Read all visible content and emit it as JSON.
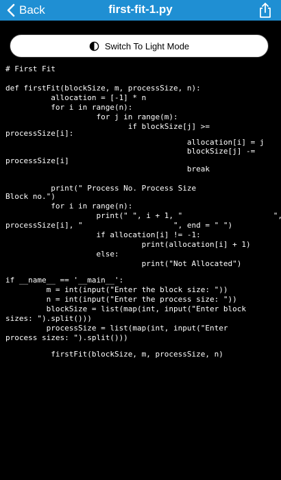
{
  "nav": {
    "back_label": "Back",
    "title": "first-fit-1.py",
    "icons": {
      "back": "chevron-left-icon",
      "share": "share-icon"
    }
  },
  "theme_toggle": {
    "label": "Switch To Light Mode",
    "icon": "half-moon-icon"
  },
  "colors": {
    "nav_bar": "#1f8fd3",
    "background": "#000000",
    "code_text": "#ffffff",
    "button_bg": "#ffffff"
  },
  "code_lines": [
    "# First Fit",
    "def firstFit(blockSize, m, processSize, n):",
    "          allocation = [-1] * n",
    "          for i in range(n):",
    "                    for j in range(m):",
    "                           if blockSize[j] >=",
    "processSize[i]:",
    "                                        allocation[i] = j",
    "                                        blockSize[j] -=",
    "processSize[i]",
    "                                        break",
    "          print(\" Process No. Process Size",
    "Block no.\")",
    "          for i in range(n):",
    "                    print(\" \", i + 1, \"                    \",",
    "processSize[i], \"                    \", end = \" \")",
    "                    if allocation[i] != -1:",
    "                              print(allocation[i] + 1)",
    "                    else:",
    "                              print(\"Not Allocated\")",
    "if __name__ == '__main__':",
    "         m = int(input(\"Enter the block size: \"))",
    "         n = int(input(\"Enter the process size: \"))",
    "         blockSize = list(map(int, input(\"Enter block",
    "sizes: \").split()))",
    "         processSize = list(map(int, input(\"Enter",
    "process sizes: \").split()))",
    "          firstFit(blockSize, m, processSize, n)"
  ]
}
